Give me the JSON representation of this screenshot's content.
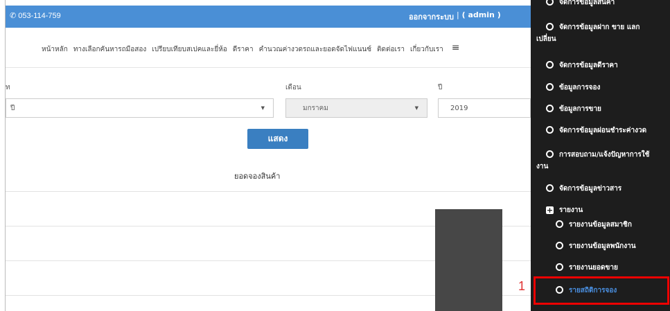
{
  "topbar": {
    "phone": "053-114-759",
    "logout": "ออกจากระบบ",
    "separator": "|",
    "user": "( admin )"
  },
  "nav": {
    "items": [
      "หน้าหลัก",
      "ทางเลือกคันหารถมือสอง",
      "เปรียบเทียบสเปคและยี่ห้อ",
      "ดีราคา",
      "คำนวณค่างวดรถและยอดจัดไฟแนนซ์",
      "ติดต่อเรา",
      "เกี่ยวกับเรา"
    ]
  },
  "form": {
    "label1_partial": "ท",
    "select1_partial": "ปี",
    "month_label": "เดือน",
    "month_value": "มกราคม",
    "year_label": "ปี",
    "year_value": "2019",
    "show_button": "แสดง",
    "table_title": "ยอดจองสินค้า"
  },
  "sidebar": {
    "items": [
      "จัดการข้อมูลสินค้า",
      "จัดการข้อมูลฝาก ขาย แลก",
      "เปลี่ยน",
      "จัดการข้อมูลดีราคา",
      "ข้อมูลการจอง",
      "ข้อมูลการขาย",
      "จัดการข้อมูลผ่อนชำระค่างวด",
      "การสอบถาม/แจ้งปัญหาการใช้",
      "งาน",
      "จัดการข้อมูลข่าวสาร",
      "รายงาน"
    ],
    "report_items": [
      "รายงานข้อมูลสมาชิก",
      "รายงานข้อมูลพนักงาน",
      "รายงานยอดขาย",
      "รายสถิติการจอง"
    ],
    "active_color": "#4a90e2"
  },
  "annotation": {
    "marker": "1",
    "highlight_color": "#e00000"
  }
}
